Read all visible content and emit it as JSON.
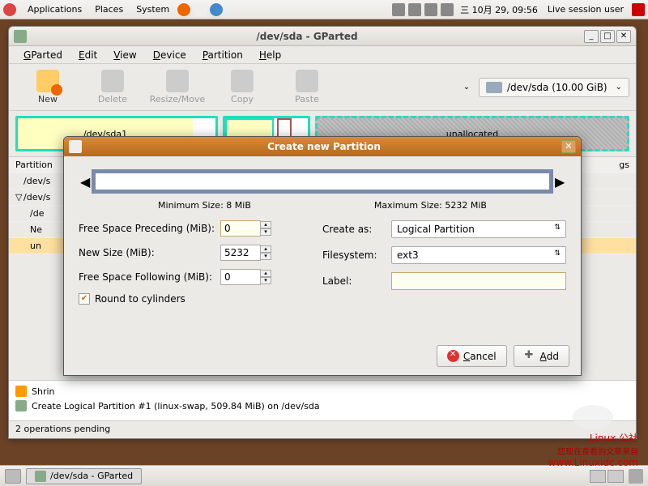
{
  "panel": {
    "menus": [
      "Applications",
      "Places",
      "System"
    ],
    "clock": "三 10月 29, 09:56",
    "user": "Live session user"
  },
  "window": {
    "title": "/dev/sda - GParted",
    "menubar": {
      "m0": "GParted",
      "m1": "Edit",
      "m2": "View",
      "m3": "Device",
      "m4": "Partition",
      "m5": "Help"
    },
    "toolbar": {
      "new": "New",
      "delete": "Delete",
      "resize": "Resize/Move",
      "copy": "Copy",
      "paste": "Paste",
      "device": "/dev/sda  (10.00 GiB)"
    },
    "diskvis": {
      "p1": "/dev/sda1",
      "unalloc": "unallocated"
    },
    "table": {
      "hdr": "Partition",
      "hdr_last": "gs",
      "rows": [
        "/dev/s",
        "/dev/s",
        "/de",
        "Ne",
        "un"
      ]
    },
    "ops": {
      "r1": "Shrin",
      "r2": "Create Logical Partition #1 (linux-swap, 509.84 MiB) on /dev/sda"
    },
    "status": "2 operations pending"
  },
  "dialog": {
    "title": "Create new Partition",
    "minsize": "Minimum Size: 8 MiB",
    "maxsize": "Maximum Size: 5232 MiB",
    "labels": {
      "preceding": "Free Space Preceding (MiB):",
      "newsize": "New Size (MiB):",
      "following": "Free Space Following (MiB):",
      "round": "Round to cylinders",
      "createas": "Create as:",
      "filesystem": "Filesystem:",
      "label": "Label:"
    },
    "values": {
      "preceding": "0",
      "newsize": "5232",
      "following": "0",
      "createas": "Logical Partition",
      "filesystem": "ext3",
      "label": ""
    },
    "buttons": {
      "cancel": "Cancel",
      "add": "Add"
    }
  },
  "taskbar": {
    "task": "/dev/sda - GParted"
  },
  "watermark": {
    "l1": "Linux 公社",
    "l2": "您现在查看的文章来自",
    "l3": "www.Linuxidc.com"
  }
}
